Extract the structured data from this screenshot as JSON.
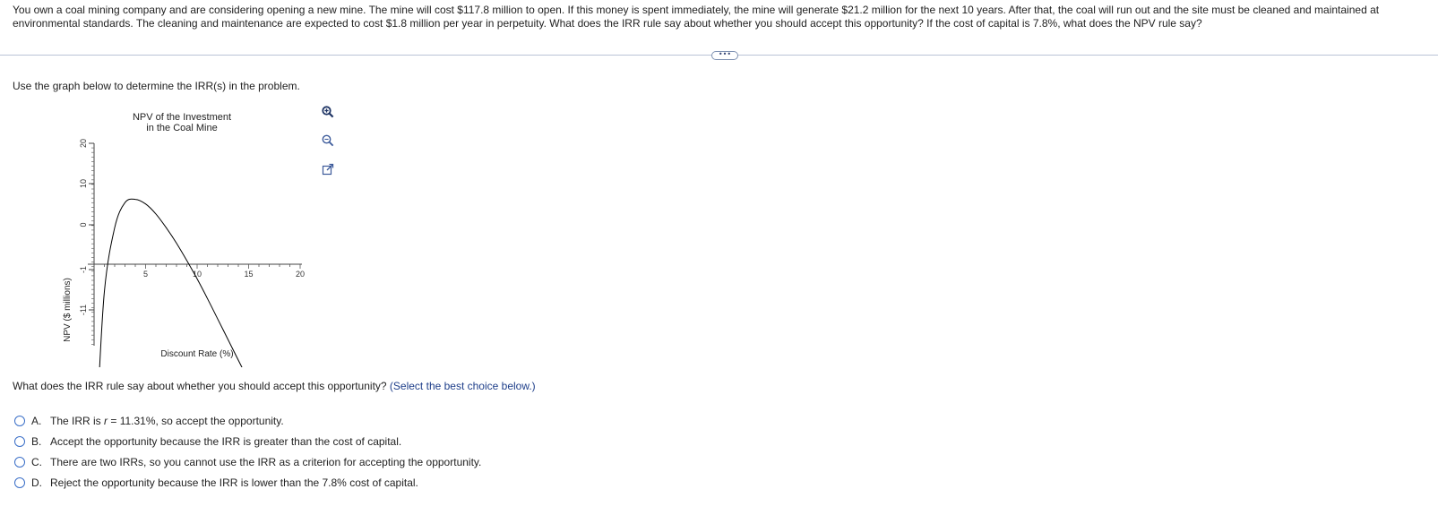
{
  "question": {
    "text": "You own a coal mining company and are considering opening a new mine. The mine will cost $117.8 million to open. If this money is spent immediately, the mine will generate $21.2 million for the next 10 years. After that, the coal will run out and the site must be cleaned and maintained at environmental standards. The cleaning and maintenance are expected to cost $1.8 million per year in perpetuity. What does the IRR rule say about whether you should accept this opportunity? If the cost of capital is 7.8%, what does the NPV rule say?"
  },
  "more_button": {
    "label": "•••"
  },
  "instruction": "Use the graph below to determine the IRR(s) in the problem.",
  "graph_tools": {
    "zoom_in_icon": "zoom-in-icon",
    "zoom_out_icon": "zoom-out-icon",
    "popout_icon": "external-link-icon"
  },
  "prompt": {
    "text": "What does the IRR rule say about whether you should accept this opportunity?",
    "hint": "(Select the best choice below.)"
  },
  "choices": [
    {
      "letter": "A.",
      "pre": "The IRR is ",
      "var": "r",
      "post": " = 11.31%, so accept the opportunity."
    },
    {
      "letter": "B.",
      "text": "Accept the opportunity because the IRR is greater than the cost of capital."
    },
    {
      "letter": "C.",
      "text": "There are two IRRs, so you cannot use the IRR as a criterion for accepting the opportunity."
    },
    {
      "letter": "D.",
      "text": "Reject the opportunity because the IRR is lower than the 7.8% cost of capital."
    }
  ],
  "chart_data": {
    "type": "line",
    "title_lines": [
      "NPV of the Investment",
      "in the Coal Mine"
    ],
    "xlabel": "Discount Rate (%)",
    "ylabel": "NPV ($ millions)",
    "x_ticks": [
      5,
      10,
      15,
      20
    ],
    "y_tick_labels": [
      "20",
      "10",
      "0",
      "-1",
      "-11"
    ],
    "xlim": [
      0,
      20
    ],
    "line_color": "#000000",
    "series": [
      {
        "x": [
          0.3,
          1,
          2,
          3,
          4,
          5,
          6,
          7,
          8,
          9,
          10,
          11,
          12,
          13,
          14,
          15,
          16,
          17
        ],
        "y": [
          -33,
          -6,
          8,
          13.5,
          14.2,
          13.2,
          11,
          8,
          4.6,
          0.8,
          -3.2,
          -7.5,
          -12,
          -16.5,
          -21,
          -25.5,
          -30,
          -34.5
        ]
      }
    ]
  }
}
